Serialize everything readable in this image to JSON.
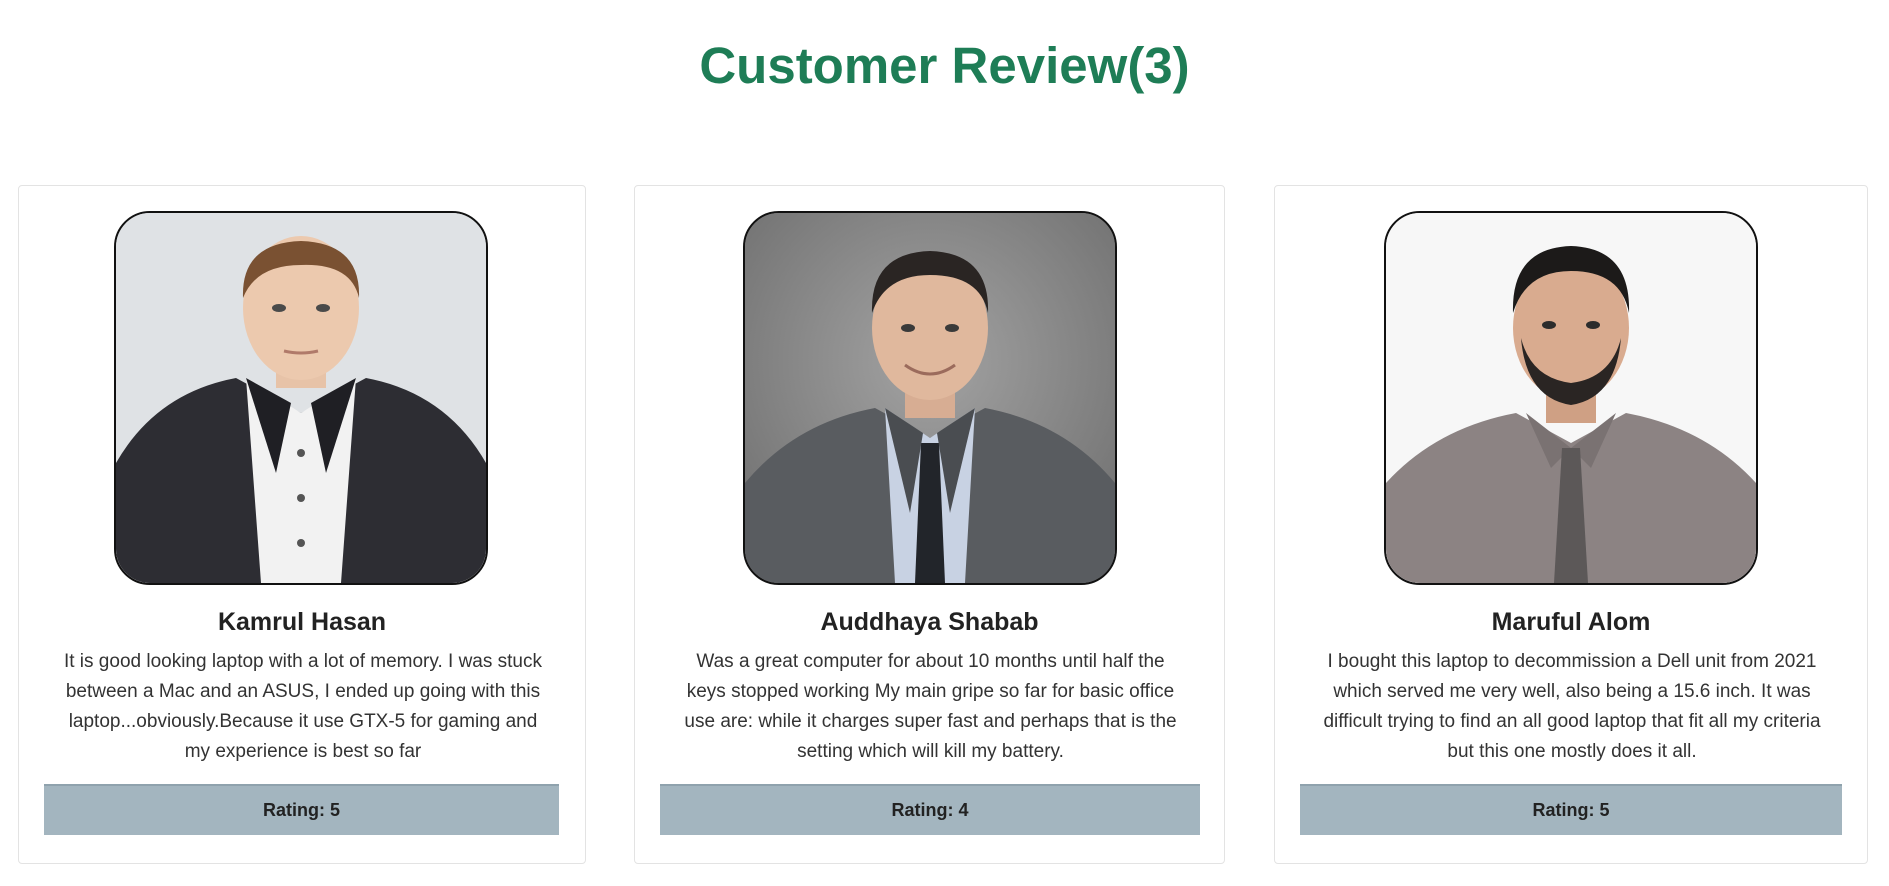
{
  "header": {
    "title": "Customer Review(3)"
  },
  "colors": {
    "title": "#1e7d56",
    "rating_bar": "#a3b5bf"
  },
  "reviews": [
    {
      "name": "Kamrul Hasan",
      "photo_icon": "person-photo",
      "text": "It is good looking laptop with a lot of memory. I was stuck between a Mac and an ASUS, I ended up going with this laptop...obviously.Because it use GTX-5 for gaming and my experience is best so far",
      "rating_label": "Rating: 5",
      "rating": 5
    },
    {
      "name": "Auddhaya Shabab",
      "photo_icon": "person-photo",
      "text": "Was a great computer for about 10 months until half the keys stopped working My main gripe so far for basic office use are: while it charges super fast and perhaps that is the setting which will kill my battery.",
      "rating_label": "Rating: 4",
      "rating": 4
    },
    {
      "name": "Maruful Alom",
      "photo_icon": "person-photo",
      "text": "I bought this laptop to decommission a Dell unit from 2021 which served me very well, also being a 15.6 inch. It was difficult trying to find an all good laptop that fit all my criteria but this one mostly does it all.",
      "rating_label": "Rating: 5",
      "rating": 5
    }
  ]
}
